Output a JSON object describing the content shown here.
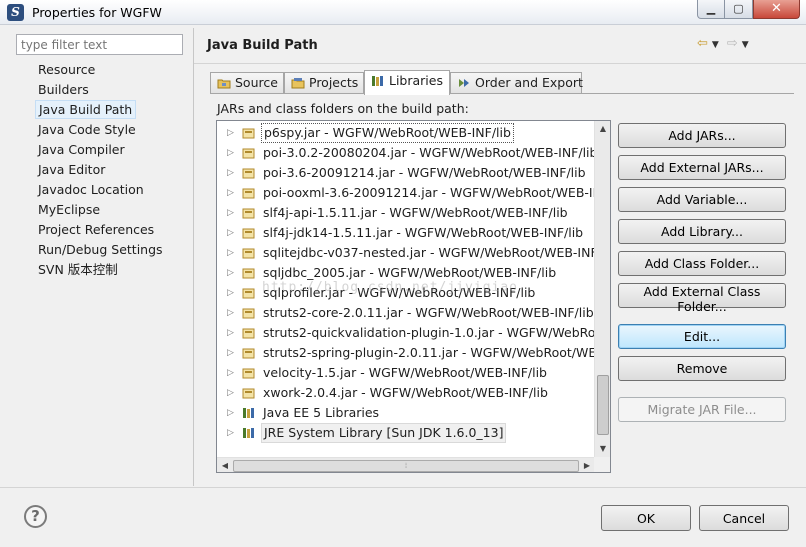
{
  "window": {
    "title": "Properties for WGFW",
    "controls": {
      "minimize": "▁",
      "maximize": "▢",
      "close": "✕"
    }
  },
  "sidebar": {
    "filter_placeholder": "type filter text",
    "items": [
      {
        "label": "Resource",
        "selected": false
      },
      {
        "label": "Builders",
        "selected": false
      },
      {
        "label": "Java Build Path",
        "selected": true
      },
      {
        "label": "Java Code Style",
        "selected": false
      },
      {
        "label": "Java Compiler",
        "selected": false
      },
      {
        "label": "Java Editor",
        "selected": false
      },
      {
        "label": "Javadoc Location",
        "selected": false
      },
      {
        "label": "MyEclipse",
        "selected": false
      },
      {
        "label": "Project References",
        "selected": false
      },
      {
        "label": "Run/Debug Settings",
        "selected": false
      },
      {
        "label": "SVN 版本控制",
        "selected": false
      }
    ]
  },
  "header": {
    "title": "Java Build Path",
    "back_icon": "⇦",
    "forward_icon": "⇨",
    "dropdown_icon": "▼",
    "menu_icon": "▼"
  },
  "tabs": [
    {
      "label": "Source",
      "active": false
    },
    {
      "label": "Projects",
      "active": false
    },
    {
      "label": "Libraries",
      "active": true
    },
    {
      "label": "Order and Export",
      "active": false
    }
  ],
  "libraries": {
    "label": "JARs and class folders on the build path:",
    "entries": [
      {
        "label": "p6spy.jar - WGFW/WebRoot/WEB-INF/lib",
        "kind": "jar"
      },
      {
        "label": "poi-3.0.2-20080204.jar - WGFW/WebRoot/WEB-INF/lib",
        "kind": "jar"
      },
      {
        "label": "poi-3.6-20091214.jar - WGFW/WebRoot/WEB-INF/lib",
        "kind": "jar"
      },
      {
        "label": "poi-ooxml-3.6-20091214.jar - WGFW/WebRoot/WEB-INF/",
        "kind": "jar"
      },
      {
        "label": "slf4j-api-1.5.11.jar - WGFW/WebRoot/WEB-INF/lib",
        "kind": "jar"
      },
      {
        "label": "slf4j-jdk14-1.5.11.jar - WGFW/WebRoot/WEB-INF/lib",
        "kind": "jar"
      },
      {
        "label": "sqlitejdbc-v037-nested.jar - WGFW/WebRoot/WEB-INF/lil",
        "kind": "jar"
      },
      {
        "label": "sqljdbc_2005.jar - WGFW/WebRoot/WEB-INF/lib",
        "kind": "jar"
      },
      {
        "label": "sqlprofiler.jar - WGFW/WebRoot/WEB-INF/lib",
        "kind": "jar"
      },
      {
        "label": "struts2-core-2.0.11.jar - WGFW/WebRoot/WEB-INF/lib",
        "kind": "jar"
      },
      {
        "label": "struts2-quickvalidation-plugin-1.0.jar - WGFW/WebRoot/V",
        "kind": "jar"
      },
      {
        "label": "struts2-spring-plugin-2.0.11.jar - WGFW/WebRoot/WEB-I",
        "kind": "jar"
      },
      {
        "label": "velocity-1.5.jar - WGFW/WebRoot/WEB-INF/lib",
        "kind": "jar"
      },
      {
        "label": "xwork-2.0.4.jar - WGFW/WebRoot/WEB-INF/lib",
        "kind": "jar"
      },
      {
        "label": "Java EE 5 Libraries",
        "kind": "library"
      },
      {
        "label": "JRE System Library [Sun JDK 1.6.0_13]",
        "kind": "library"
      }
    ],
    "watermark": "http://blog.csdn.net/jiyiqiao"
  },
  "buttons": {
    "add_jars": "Add JARs...",
    "add_external_jars": "Add External JARs...",
    "add_variable": "Add Variable...",
    "add_library": "Add Library...",
    "add_class_folder": "Add Class Folder...",
    "add_external_class_folder": "Add External Class Folder...",
    "edit": "Edit...",
    "remove": "Remove",
    "migrate_jar": "Migrate JAR File..."
  },
  "footer": {
    "help_icon": "?",
    "ok": "OK",
    "cancel": "Cancel"
  },
  "colors": {
    "jar_icon": "#d9b24a",
    "library_icon": "#4a7a2c",
    "selection": "#e5f1fb",
    "default_button": "#bee6fd"
  }
}
